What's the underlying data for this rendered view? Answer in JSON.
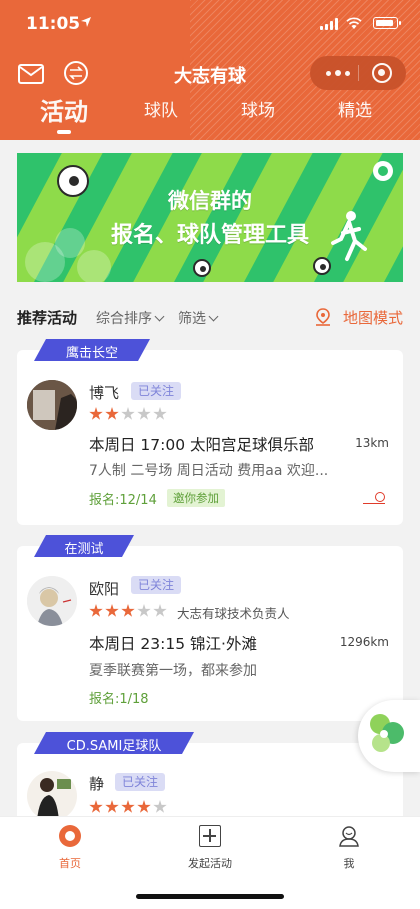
{
  "status_bar": {
    "time": "11:05",
    "location_icon": "location-arrow-icon"
  },
  "navbar": {
    "title": "大志有球",
    "mail_icon": "mail-icon",
    "switch_icon": "swap-icon",
    "more_icon": "more-dots-icon",
    "close_icon": "close-circle-icon"
  },
  "tabs": [
    {
      "label": "活动",
      "active": true
    },
    {
      "label": "球队",
      "active": false
    },
    {
      "label": "球场",
      "active": false
    },
    {
      "label": "精选",
      "active": false
    }
  ],
  "banner": {
    "line1": "微信群的",
    "line2": "报名、球队管理工具"
  },
  "filters": {
    "recommended": "推荐活动",
    "sort": "综合排序",
    "filter": "筛选",
    "map_mode": "地图模式"
  },
  "activities": [
    {
      "group": "鹰击长空",
      "name": "博飞",
      "follow_label": "已关注",
      "rating": 2,
      "role": "",
      "time_location": "本周日 17:00  太阳宫足球俱乐部",
      "distance": "13km",
      "description": "7人制 二号场 周日活动 费用aa 欢迎...",
      "signup": "报名:12/14",
      "invite": "邀你参加"
    },
    {
      "group": "在测试",
      "name": "欧阳",
      "follow_label": "已关注",
      "rating": 3,
      "role": "大志有球技术负责人",
      "time_location": "本周日 23:15  锦江·外滩",
      "distance": "1296km",
      "description": "夏季联赛第一场，都来参加",
      "signup": "报名:1/18"
    },
    {
      "group": "CD.SAMI足球队",
      "name": "静",
      "follow_label": "已关注",
      "rating": 4
    }
  ],
  "tabbar": [
    {
      "label": "首页",
      "icon": "home-ball-icon",
      "active": true
    },
    {
      "label": "发起活动",
      "icon": "add-square-icon",
      "active": false
    },
    {
      "label": "我",
      "icon": "profile-icon",
      "active": false
    }
  ],
  "colors": {
    "brand": "#e9683a",
    "tag": "#4d52d9",
    "green": "#2fc26b",
    "signup": "#5fa03a"
  }
}
